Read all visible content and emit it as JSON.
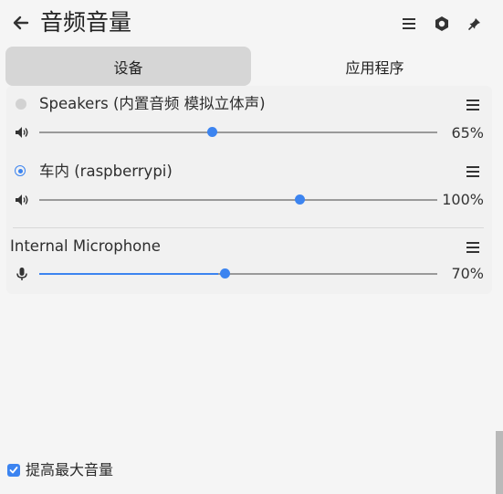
{
  "header": {
    "title": "音频音量"
  },
  "tabs": [
    {
      "label": "设备"
    },
    {
      "label": "应用程序"
    }
  ],
  "devices": [
    {
      "label": "Speakers (内置音频 模拟立体声)",
      "volume_percent": 65,
      "volume_label": "65%",
      "selected": false
    },
    {
      "label": "车内 (raspberrypi)",
      "volume_percent": 100,
      "volume_label": "100%",
      "selected": true
    }
  ],
  "microphone": {
    "label": "Internal Microphone",
    "volume_percent": 70,
    "volume_label": "70%",
    "level_percent": 45
  },
  "footer": {
    "raise_max_volume_label": "提高最大音量",
    "raise_max_volume_checked": true
  },
  "colors": {
    "accent": "#3c84f0",
    "active_tab": "#d6d6d6",
    "background": "#f5f5f5"
  }
}
